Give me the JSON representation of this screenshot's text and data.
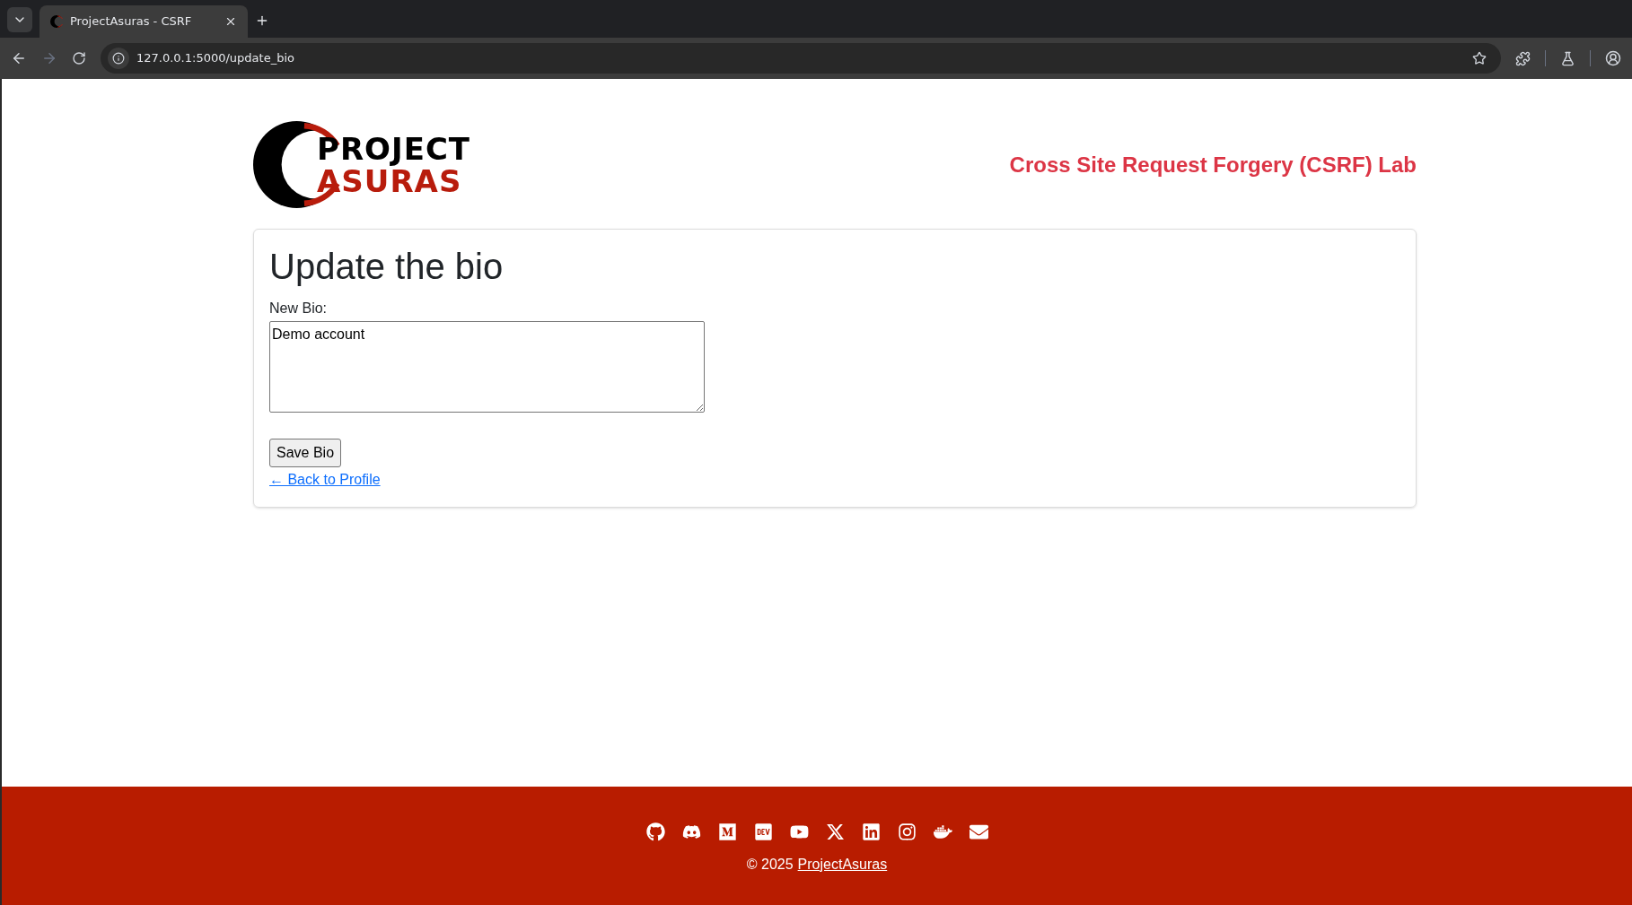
{
  "browser": {
    "tab": {
      "title": "ProjectAsuras - CSRF",
      "selected": true
    },
    "address": "127.0.0.1:5000/update_bio"
  },
  "header": {
    "logo": {
      "line_1": "PROJECT",
      "line_2": "ASURAS"
    },
    "lab_title": "Cross Site Request Forgery (CSRF) Lab"
  },
  "card": {
    "heading": "Update the bio",
    "field_label": "New Bio:",
    "bio_value": "Demo account",
    "save_button": "Save Bio",
    "back_link": "← Back to Profile"
  },
  "footer": {
    "social_icons": [
      {
        "kind": "github"
      },
      {
        "kind": "discord"
      },
      {
        "kind": "medium"
      },
      {
        "kind": "dev"
      },
      {
        "kind": "youtube"
      },
      {
        "kind": "x"
      },
      {
        "kind": "linkedin"
      },
      {
        "kind": "instagram"
      },
      {
        "kind": "docker"
      },
      {
        "kind": "email"
      }
    ],
    "copyright": "© 2025",
    "copyright_link": "ProjectAsuras"
  }
}
